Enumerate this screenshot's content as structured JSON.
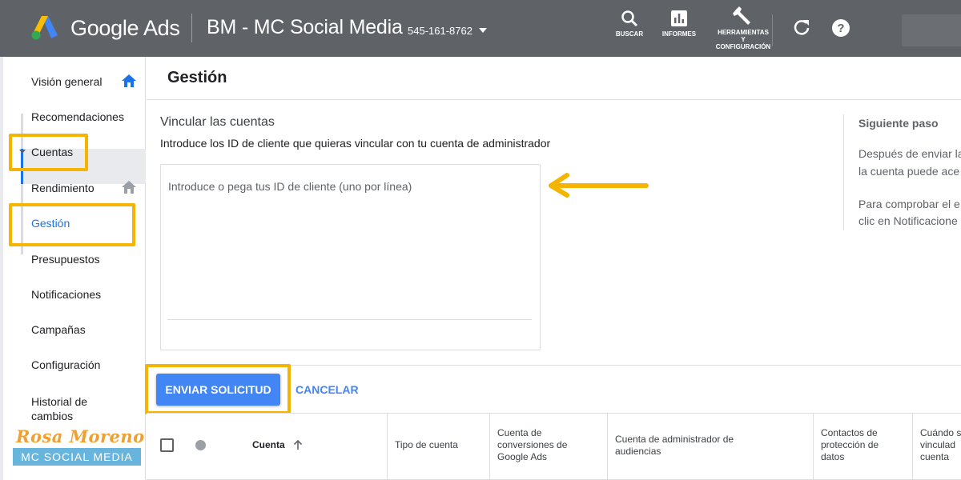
{
  "header": {
    "brand": "Google Ads",
    "account_name": "BM - MC Social Media",
    "account_id": "545-161-8762",
    "tools": [
      {
        "label": "BUSCAR",
        "icon": "search-icon"
      },
      {
        "label": "INFORMES",
        "icon": "reports-icon"
      },
      {
        "label_lines": [
          "HERRAMIENTAS",
          "Y",
          "CONFIGURACIÓN"
        ],
        "icon": "wrench-icon"
      }
    ],
    "refresh_icon": "refresh-icon",
    "help_icon": "help-icon"
  },
  "sidebar": {
    "items": [
      {
        "label": "Visión general",
        "icon": "home-icon"
      },
      {
        "label": "Recomendaciones"
      },
      {
        "label": "Cuentas",
        "icon": "caret-down-icon"
      },
      {
        "label": "Rendimiento",
        "icon": "home-icon"
      },
      {
        "label": "Gestión",
        "active": true
      },
      {
        "label": "Presupuestos"
      },
      {
        "label": "Notificaciones"
      },
      {
        "label": "Campañas"
      },
      {
        "label": "Configuración"
      },
      {
        "label_lines": [
          "Historial de",
          "cambios"
        ]
      }
    ]
  },
  "page": {
    "title": "Gestión"
  },
  "link_section": {
    "title": "Vincular las cuentas",
    "description": "Introduce los ID de cliente que quieras vincular con tu cuenta de administrador",
    "textarea_placeholder": "Introduce o pega tus ID de cliente (uno por línea)"
  },
  "next_step": {
    "title": "Siguiente paso",
    "lines": [
      "Después de enviar la",
      "la cuenta puede ace",
      "Para comprobar el e",
      "clic en Notificacione"
    ]
  },
  "actions": {
    "send": "ENVIAR SOLICITUD",
    "cancel": "CANCELAR"
  },
  "table": {
    "columns": [
      {
        "label": "Cuenta"
      },
      {
        "label": "Tipo de cuenta"
      },
      {
        "label_lines": [
          "Cuenta de",
          "conversiones de",
          "Google Ads"
        ]
      },
      {
        "label_lines": [
          "Cuenta de administrador de",
          "audiencias"
        ]
      },
      {
        "label_lines": [
          "Contactos de",
          "protección de",
          "datos"
        ]
      },
      {
        "label_lines": [
          "Cuándo s",
          "vinculad",
          "cuenta"
        ]
      }
    ]
  },
  "watermark": {
    "name": "Rosa Moreno",
    "tagline": "MC SOCIAL MEDIA"
  },
  "colors": {
    "topbar": "#5f6368",
    "highlight": "#f4b400",
    "primary_button": "#4285f4",
    "link": "#4285f4",
    "active_bar": "#1a73e8"
  }
}
